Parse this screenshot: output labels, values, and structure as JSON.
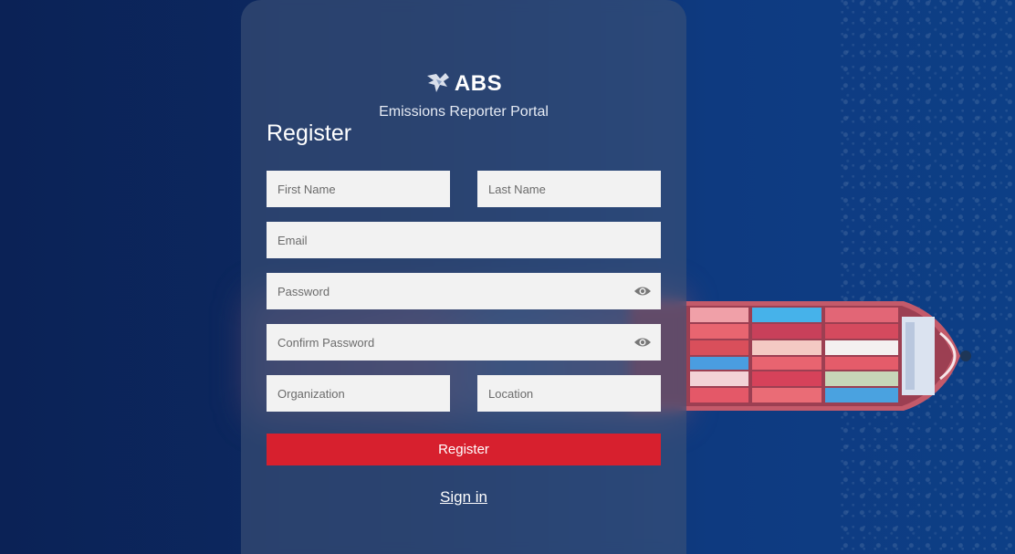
{
  "brand": {
    "logo_text": "ABS",
    "portal_name": "Emissions Reporter Portal",
    "logo_icon": "eagle-icon"
  },
  "form": {
    "title": "Register",
    "first_name": {
      "placeholder": "First Name",
      "value": ""
    },
    "last_name": {
      "placeholder": "Last Name",
      "value": ""
    },
    "email": {
      "placeholder": "Email",
      "value": ""
    },
    "password": {
      "placeholder": "Password",
      "value": "",
      "toggle_icon": "eye-icon"
    },
    "confirm_password": {
      "placeholder": "Confirm Password",
      "value": "",
      "toggle_icon": "eye-icon"
    },
    "organization": {
      "placeholder": "Organization",
      "value": ""
    },
    "location": {
      "placeholder": "Location",
      "value": ""
    },
    "submit_label": "Register",
    "signin_label": "Sign in"
  },
  "colors": {
    "accent": "#d7202e",
    "background": "#0c2a63",
    "field_background": "#f2f2f2"
  }
}
